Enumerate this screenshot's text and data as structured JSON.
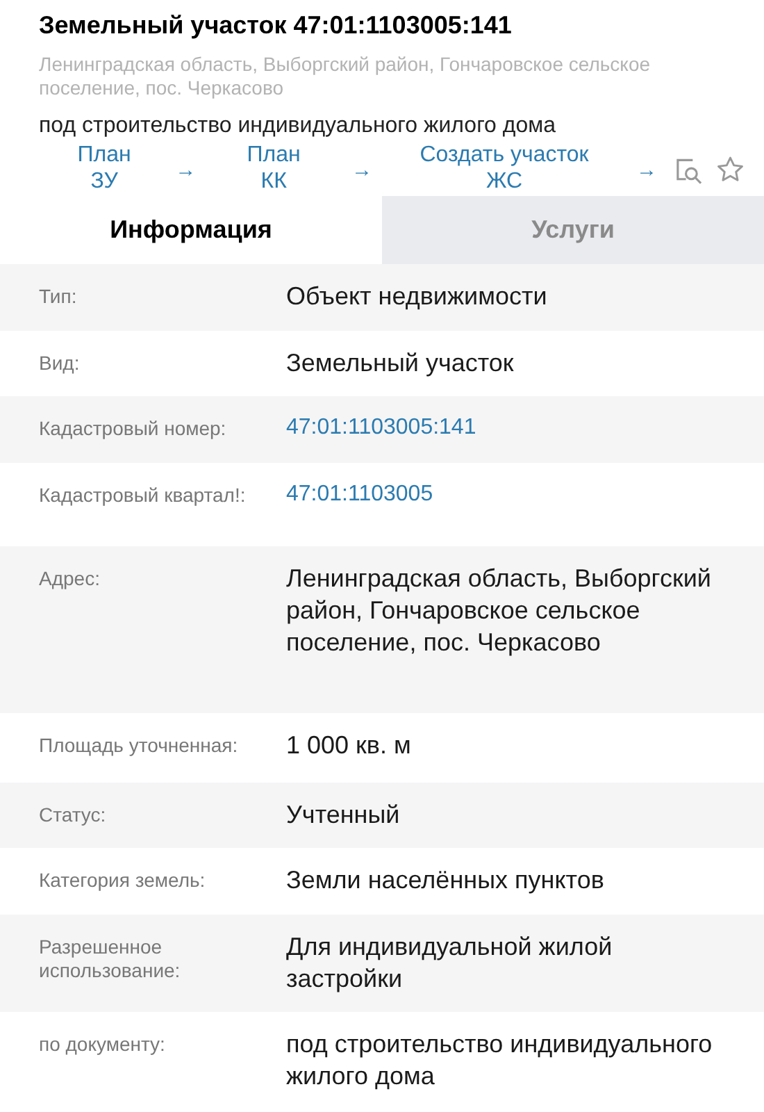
{
  "header": {
    "title": "Земельный участок 47:01:1103005:141",
    "address": "Ленинградская область, Выборгский район, Гончаровское сельское поселение, пос. Черкасово",
    "purpose": "под строительство индивидуального жилого дома"
  },
  "actions": [
    {
      "label": "План\nЗУ",
      "arrow": "→"
    },
    {
      "label": "План\nКК",
      "arrow": "→"
    },
    {
      "label": "Создать участок\nЖС",
      "arrow": "→"
    }
  ],
  "tabs": [
    {
      "label": "Информация",
      "selected": true
    },
    {
      "label": "Услуги",
      "selected": false
    }
  ],
  "rows": [
    {
      "label": "Тип:",
      "value": "Объект недвижимости",
      "kind": "text"
    },
    {
      "label": "Вид:",
      "value": "Земельный участок",
      "kind": "text"
    },
    {
      "label": "Кадастровый номер:",
      "value": "47:01:1103005:141",
      "kind": "link"
    },
    {
      "label": "Кадастровый квартал!:",
      "value": "47:01:1103005",
      "kind": "link"
    },
    {
      "label": "Адрес:",
      "value": "Ленинградская область, Выборгский район, Гончаровское сельское поселение, пос. Черкасово",
      "kind": "text"
    },
    {
      "label": "Площадь уточненная:",
      "value": "1 000 кв. м",
      "kind": "text"
    },
    {
      "label": "Статус:",
      "value": "Учтенный",
      "kind": "text"
    },
    {
      "label": "Категория земель:",
      "value": "Земли населённых пунктов",
      "kind": "text"
    },
    {
      "label": "Разрешенное использование:",
      "value": "Для индивидуальной жилой застройки",
      "kind": "text"
    },
    {
      "label": "по документу:",
      "value": "под строительство индивидуального жилого дома",
      "kind": "text"
    }
  ]
}
